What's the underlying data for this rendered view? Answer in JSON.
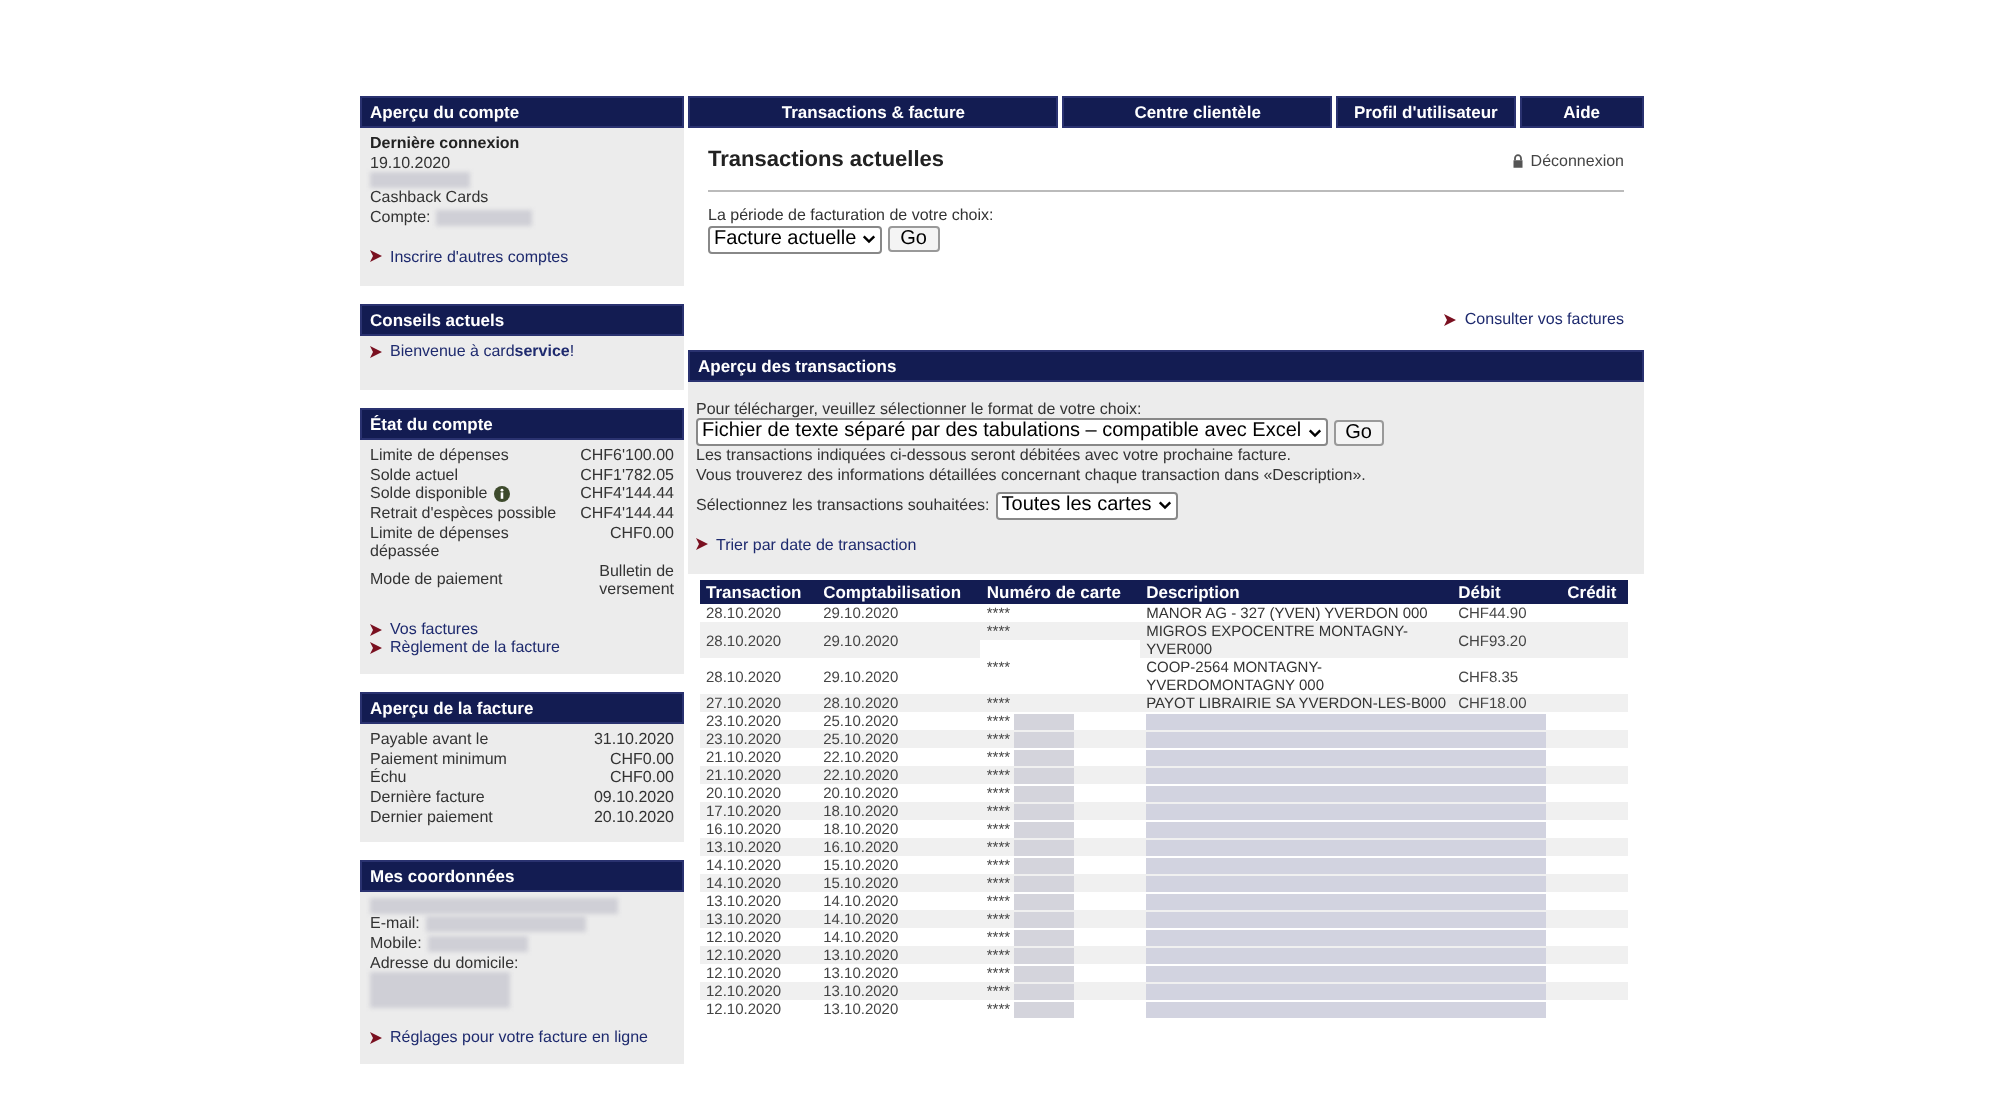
{
  "nav": {
    "sidebar_title": "Aperçu du compte",
    "tabs": [
      "Transactions & facture",
      "Centre clientèle",
      "Profil d'utilisateur",
      "Aide"
    ]
  },
  "sidebar": {
    "account": {
      "last_login_label": "Dernière connexion",
      "last_login_date": "19.10.2020",
      "program": "Cashback Cards",
      "account_label": "Compte:",
      "link": "Inscrire d'autres comptes"
    },
    "tips": {
      "title": "Conseils actuels",
      "link": "Bienvenue à card**service**!"
    },
    "status": {
      "title": "État du compte",
      "rows": [
        {
          "label": "Limite de dépenses",
          "value": "CHF6'100.00",
          "info": false
        },
        {
          "label": "Solde actuel",
          "value": "CHF1'782.05",
          "info": false
        },
        {
          "label": "Solde disponible",
          "value": "CHF4'144.44",
          "info": true
        },
        {
          "label": "Retrait d'espèces possible",
          "value": "CHF4'144.44",
          "info": false
        },
        {
          "label": "Limite de dépenses dépassée",
          "value": "CHF0.00",
          "info": false
        },
        {
          "label": "Mode de paiement",
          "value": "Bulletin de versement",
          "info": false
        }
      ],
      "links": [
        "Vos factures",
        "Règlement de la facture"
      ]
    },
    "invoice": {
      "title": "Aperçu de la facture",
      "rows": [
        {
          "label": "Payable avant le",
          "value": "31.10.2020"
        },
        {
          "label": "Paiement minimum",
          "value": "CHF0.00"
        },
        {
          "label": "Échu",
          "value": "CHF0.00"
        },
        {
          "label": "Dernière facture",
          "value": "09.10.2020"
        },
        {
          "label": "Dernier paiement",
          "value": "20.10.2020"
        }
      ]
    },
    "contact": {
      "title": "Mes coordonnées",
      "email_label": "E-mail:",
      "mobile_label": "Mobile:",
      "address_label": "Adresse du domicile:",
      "link": "Réglages pour votre facture en ligne"
    }
  },
  "main": {
    "title": "Transactions actuelles",
    "logout": "Déconnexion",
    "period_label": "La période de facturation de votre choix:",
    "period_value": "Facture actuelle",
    "go": "Go",
    "invoices_link": "Consulter vos factures",
    "panel_title": "Aperçu des transactions",
    "download_label": "Pour télécharger, veuillez sélectionner le format de votre choix:",
    "format_value": "Fichier de texte séparé par des tabulations – compatible avec Excel",
    "go2": "Go",
    "notes": [
      "Les transactions indiquées ci-dessous seront débitées avec votre prochaine facture.",
      "Vous trouverez des informations détaillées concernant chaque transaction dans «Description»."
    ],
    "filter_label": "Sélectionnez les transactions souhaitées:",
    "filter_value": "Toutes les cartes",
    "sort_link": "Trier par date de transaction"
  },
  "table": {
    "columns": [
      "Transaction",
      "Comptabilisation",
      "Numéro de carte",
      "Description",
      "Débit",
      "Crédit"
    ],
    "rows": [
      {
        "transaction": "28.10.2020",
        "booking": "29.10.2020",
        "card": "****",
        "description": "MANOR AG - 327 (YVEN) YVERDON 000",
        "debit": "CHF44.90",
        "redacted": false
      },
      {
        "transaction": "28.10.2020",
        "booking": "29.10.2020",
        "card": "****",
        "description": "MIGROS EXPOCENTRE MONTAGNY-YVER000",
        "debit": "CHF93.20",
        "redacted": false
      },
      {
        "transaction": "28.10.2020",
        "booking": "29.10.2020",
        "card": "****",
        "description": "COOP-2564 MONTAGNY-YVERDOMONTAGNY 000",
        "debit": "CHF8.35",
        "redacted": false
      },
      {
        "transaction": "27.10.2020",
        "booking": "28.10.2020",
        "card": "****",
        "description": "PAYOT LIBRAIRIE SA YVERDON-LES-B000",
        "debit": "CHF18.00",
        "redacted": false
      },
      {
        "transaction": "23.10.2020",
        "booking": "25.10.2020",
        "card": "****",
        "redacted": true
      },
      {
        "transaction": "23.10.2020",
        "booking": "25.10.2020",
        "card": "****",
        "redacted": true
      },
      {
        "transaction": "21.10.2020",
        "booking": "22.10.2020",
        "card": "****",
        "redacted": true
      },
      {
        "transaction": "21.10.2020",
        "booking": "22.10.2020",
        "card": "****",
        "redacted": true
      },
      {
        "transaction": "20.10.2020",
        "booking": "20.10.2020",
        "card": "****",
        "redacted": true
      },
      {
        "transaction": "17.10.2020",
        "booking": "18.10.2020",
        "card": "****",
        "redacted": true
      },
      {
        "transaction": "16.10.2020",
        "booking": "18.10.2020",
        "card": "****",
        "redacted": true
      },
      {
        "transaction": "13.10.2020",
        "booking": "16.10.2020",
        "card": "****",
        "redacted": true
      },
      {
        "transaction": "14.10.2020",
        "booking": "15.10.2020",
        "card": "****",
        "redacted": true
      },
      {
        "transaction": "14.10.2020",
        "booking": "15.10.2020",
        "card": "****",
        "redacted": true
      },
      {
        "transaction": "13.10.2020",
        "booking": "14.10.2020",
        "card": "****",
        "redacted": true
      },
      {
        "transaction": "13.10.2020",
        "booking": "14.10.2020",
        "card": "****",
        "redacted": true
      },
      {
        "transaction": "12.10.2020",
        "booking": "14.10.2020",
        "card": "****",
        "redacted": true
      },
      {
        "transaction": "12.10.2020",
        "booking": "13.10.2020",
        "card": "****",
        "redacted": true
      },
      {
        "transaction": "12.10.2020",
        "booking": "13.10.2020",
        "card": "****",
        "redacted": true
      },
      {
        "transaction": "12.10.2020",
        "booking": "13.10.2020",
        "card": "****",
        "redacted": true
      },
      {
        "transaction": "12.10.2020",
        "booking": "13.10.2020",
        "card": "****",
        "redacted": true
      }
    ]
  }
}
